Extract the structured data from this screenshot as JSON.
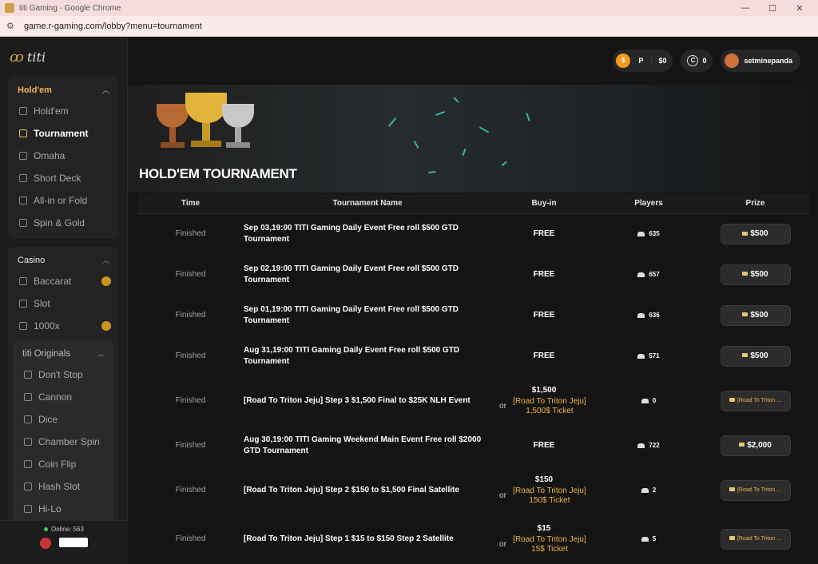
{
  "window": {
    "title": "titi Gaming - Google Chrome",
    "url": "game.r-gaming.com/lobby?menu=tournament"
  },
  "sidebar": {
    "logo_text": "titi",
    "holdem_group": {
      "label": "Hold'em",
      "items": [
        {
          "label": "Hold'em",
          "selected": false
        },
        {
          "label": "Tournament",
          "selected": true
        },
        {
          "label": "Omaha",
          "selected": false
        },
        {
          "label": "Short Deck",
          "selected": false
        },
        {
          "label": "All-in or Fold",
          "selected": false
        },
        {
          "label": "Spin & Gold",
          "selected": false
        }
      ]
    },
    "casino_group": {
      "label": "Casino",
      "items": [
        {
          "label": "Baccarat",
          "badge": true
        },
        {
          "label": "Slot",
          "badge": false
        },
        {
          "label": "1000x",
          "badge": true
        }
      ]
    },
    "originals_group": {
      "label": "titi Originals",
      "items": [
        {
          "label": "Don't Stop"
        },
        {
          "label": "Cannon"
        },
        {
          "label": "Dice"
        },
        {
          "label": "Chamber Spin"
        },
        {
          "label": "Coin Flip"
        },
        {
          "label": "Hash Slot"
        },
        {
          "label": "Hi-Lo"
        }
      ]
    },
    "online_text": "Online: 563"
  },
  "topbar": {
    "wallet_symbol": "$",
    "wallet_p": "P",
    "wallet_amount": "$0",
    "coin_symbol": "C",
    "coin_amount": "0",
    "username": "setminepanda"
  },
  "page_title": "HOLD'EM TOURNAMENT",
  "table": {
    "headers": [
      "Time",
      "Tournament Name",
      "Buy-in",
      "Players",
      "Prize"
    ],
    "rows": [
      {
        "time": "Finished",
        "name": "Sep 03,19:00 TITI Gaming Daily Event Free roll $500 GTD Tournament",
        "buyin": "FREE",
        "alt": "",
        "players": "635",
        "prize": "$500",
        "tix": false
      },
      {
        "time": "Finished",
        "name": "Sep 02,19:00 TITI Gaming Daily Event Free roll $500 GTD Tournament",
        "buyin": "FREE",
        "alt": "",
        "players": "657",
        "prize": "$500",
        "tix": false
      },
      {
        "time": "Finished",
        "name": "Sep 01,19:00 TITI Gaming Daily Event Free roll $500 GTD Tournament",
        "buyin": "FREE",
        "alt": "",
        "players": "636",
        "prize": "$500",
        "tix": false
      },
      {
        "time": "Finished",
        "name": "Aug 31,19:00 TITI Gaming Daily Event Free roll $500 GTD Tournament",
        "buyin": "FREE",
        "alt": "",
        "players": "571",
        "prize": "$500",
        "tix": false
      },
      {
        "time": "Finished",
        "name": "[Road To Triton Jeju] Step 3 $1,500 Final to $25K NLH Event",
        "buyin": "$1,500",
        "alt": "[Road To Triton Jeju] 1,500$ Ticket",
        "players": "0",
        "prize": "[Road To Triton ...",
        "tix": true
      },
      {
        "time": "Finished",
        "name": "Aug 30,19:00 TITI Gaming Weekend Main Event Free roll $2000 GTD Tournament",
        "buyin": "FREE",
        "alt": "",
        "players": "722",
        "prize": "$2,000",
        "tix": false
      },
      {
        "time": "Finished",
        "name": "[Road To Triton Jeju] Step 2 $150 to $1,500 Final Satellite",
        "buyin": "$150",
        "alt": "[Road To Triton Jeju] 150$ Ticket",
        "players": "2",
        "prize": "[Road To Triton ...",
        "tix": true
      },
      {
        "time": "Finished",
        "name": "[Road To Triton Jeju] Step 1 $15 to $150 Step 2 Satellite",
        "buyin": "$15",
        "alt": "[Road To Triton Jeju] 15$ Ticket",
        "players": "5",
        "prize": "[Road To Triton ...",
        "tix": true
      }
    ],
    "or_text": "or"
  }
}
